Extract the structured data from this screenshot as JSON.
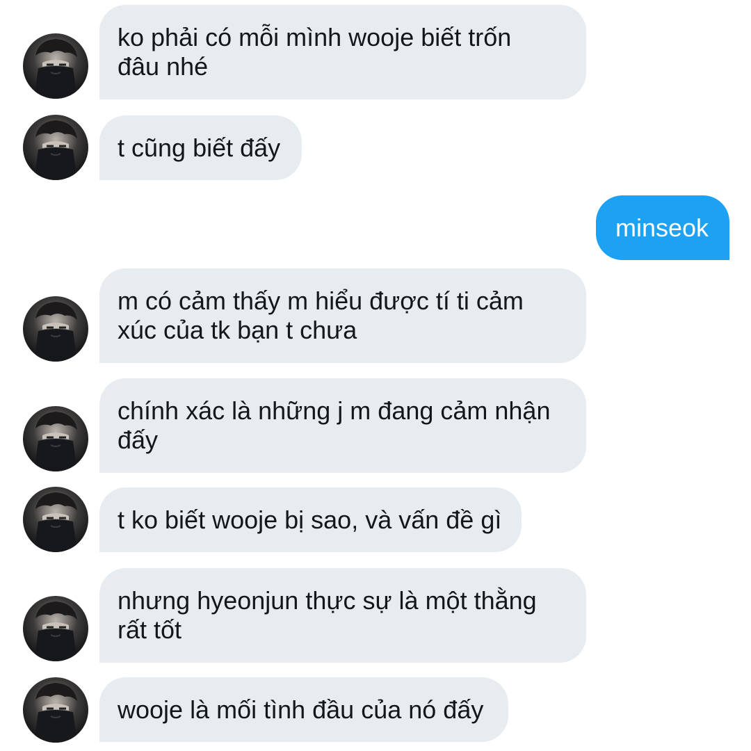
{
  "conversation": {
    "messages": [
      {
        "direction": "incoming",
        "text": "ko phải có mỗi mình wooje biết trốn\nđâu nhé"
      },
      {
        "direction": "incoming",
        "text": "t cũng biết đấy"
      },
      {
        "direction": "outgoing",
        "text": "minseok"
      },
      {
        "direction": "incoming",
        "text": "m có cảm thấy m hiểu được tí ti cảm\nxúc của tk bạn t chưa"
      },
      {
        "direction": "incoming",
        "text": "chính xác là những j m đang cảm nhận\nđấy"
      },
      {
        "direction": "incoming",
        "text": "t ko biết wooje bị sao, và vấn đề gì"
      },
      {
        "direction": "incoming",
        "text": "nhưng hyeonjun thực sự là một thằng\nrất tốt"
      },
      {
        "direction": "incoming",
        "text": "wooje là mối tình đầu của nó đấy"
      }
    ]
  },
  "colors": {
    "incoming_bubble": "#e6ecf0",
    "outgoing_bubble": "#1da1f2",
    "incoming_text": "#14171a",
    "outgoing_text": "#ffffff"
  },
  "icons": {
    "avatar": "profile-photo-masked-person"
  }
}
